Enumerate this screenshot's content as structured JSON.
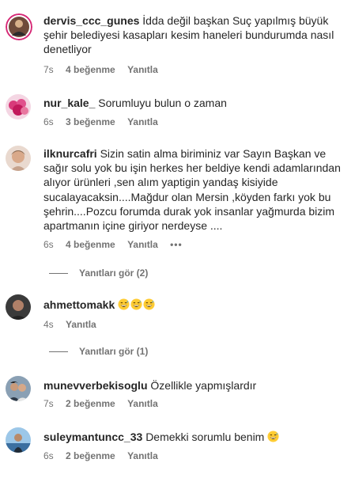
{
  "comments": [
    {
      "username": "dervis_ccc_gunes",
      "text": "İdda değil başkan Suç yapılmış büyük şehir belediyesi kasapları kesim haneleri bundurumda nasıl denetliyor",
      "time": "7s",
      "likes": "4 beğenme",
      "reply": "Yanıtla"
    },
    {
      "username": "nur_kale_",
      "text": "Sorumluyu bulun o zaman",
      "time": "6s",
      "likes": "3 beğenme",
      "reply": "Yanıtla"
    },
    {
      "username": "ilknurcafri",
      "text": "Sizin satin alma biriminiz var Sayın Başkan ve sağır solu yok bu işin herkes her beldiye kendi adamlarından alıyor ürünleri ,sen alım yaptigin yandaş kisiyide sucalayacaksin....Mağdur olan Mersin ,köyden farkı yok bu şehrin....Pozcu forumda durak yok insanlar yağmurda bizim apartmanın içine giriyor nerdeyse ....",
      "time": "6s",
      "likes": "4 beğenme",
      "reply": "Yanıtla",
      "more": "•••",
      "view_replies": "Yanıtları gör (2)"
    },
    {
      "username": "ahmettomakk",
      "text": "",
      "emoji": "grinning-sweat-face",
      "time": "4s",
      "reply": "Yanıtla",
      "view_replies": "Yanıtları gör (1)"
    },
    {
      "username": "munevverbekisoglu",
      "text": "Özellikle yapmışlardır",
      "time": "7s",
      "likes": "2 beğenme",
      "reply": "Yanıtla"
    },
    {
      "username": "suleymantuncc_33",
      "text": "Demekki sorumlu benim",
      "emoji": "grinning-sweat-face",
      "time": "6s",
      "likes": "2 beğenme",
      "reply": "Yanıtla"
    }
  ],
  "colors": {
    "text": "#262626",
    "meta": "#737373",
    "story_ring": "#d62976"
  }
}
